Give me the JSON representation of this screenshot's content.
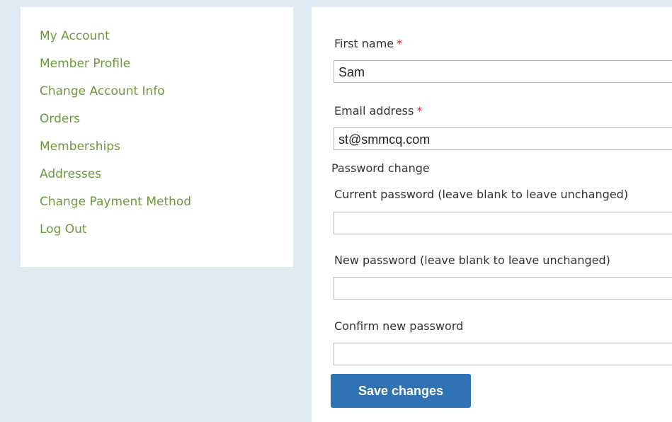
{
  "sidebar": {
    "items": [
      {
        "label": "My Account"
      },
      {
        "label": "Member Profile"
      },
      {
        "label": "Change Account Info"
      },
      {
        "label": "Orders"
      },
      {
        "label": "Memberships"
      },
      {
        "label": "Addresses"
      },
      {
        "label": "Change Payment Method"
      },
      {
        "label": "Log Out"
      }
    ]
  },
  "form": {
    "first_name": {
      "label": "First name",
      "required_mark": "*",
      "value": "Sam"
    },
    "email": {
      "label": "Email address",
      "required_mark": "*",
      "value": "st@smmcq.com"
    },
    "password_section": {
      "title": "Password change"
    },
    "current_password": {
      "label": "Current password (leave blank to leave unchanged)",
      "value": ""
    },
    "new_password": {
      "label": "New password (leave blank to leave unchanged)",
      "value": ""
    },
    "confirm_password": {
      "label": "Confirm new password",
      "value": ""
    },
    "save_label": "Save changes"
  },
  "colors": {
    "background": "#ddeaf3",
    "nav_link": "#6c9a3c",
    "required": "#d9262b",
    "button": "#2f73b4"
  }
}
